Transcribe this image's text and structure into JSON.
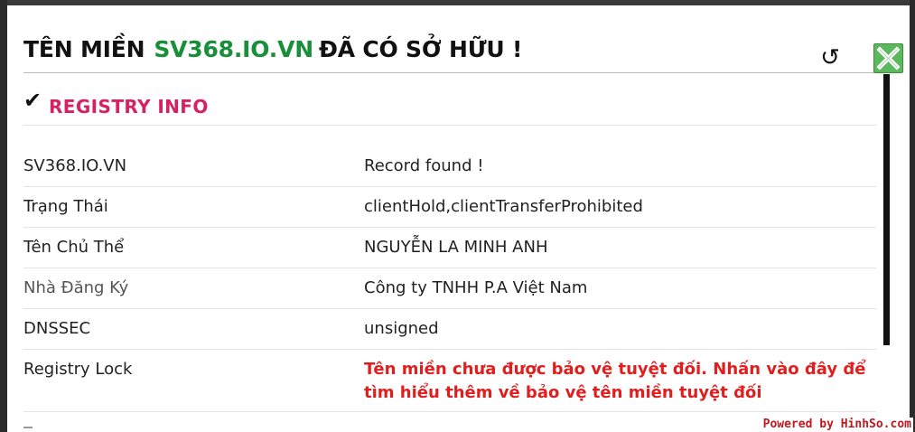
{
  "header": {
    "title_prefix": "TÊN MIỀN",
    "domain": "SV368.IO.VN",
    "title_suffix": "ĐÃ CÓ SỞ HỮU !",
    "refresh_icon": "↺",
    "close_icon": "close-x-icon"
  },
  "section": {
    "check_icon": "✔",
    "title": "REGISTRY INFO"
  },
  "rows": [
    {
      "label": "SV368.IO.VN",
      "value": "Record found !"
    },
    {
      "label": "Trạng Thái",
      "value": "clientHold,clientTransferProhibited"
    },
    {
      "label": "Tên Chủ Thể",
      "value": "NGUYỄN LA MINH ANH"
    },
    {
      "label": "Nhà Đăng Ký",
      "value": "Công ty TNHH P.A Việt Nam"
    },
    {
      "label": "DNSSEC",
      "value": "unsigned"
    },
    {
      "label": "Registry Lock",
      "value": "Tên miền chưa được bảo vệ tuyệt đối. Nhấn vào đây để tìm hiểu thêm về bảo vệ tên miền tuyệt đối"
    }
  ],
  "watermark": "Powered by HinhSo.com",
  "colors": {
    "domain_green": "#1a8f3a",
    "section_pink": "#d62261",
    "warning_red": "#e01e1e",
    "close_green": "#58b14d",
    "watermark_red": "#c0181f"
  }
}
